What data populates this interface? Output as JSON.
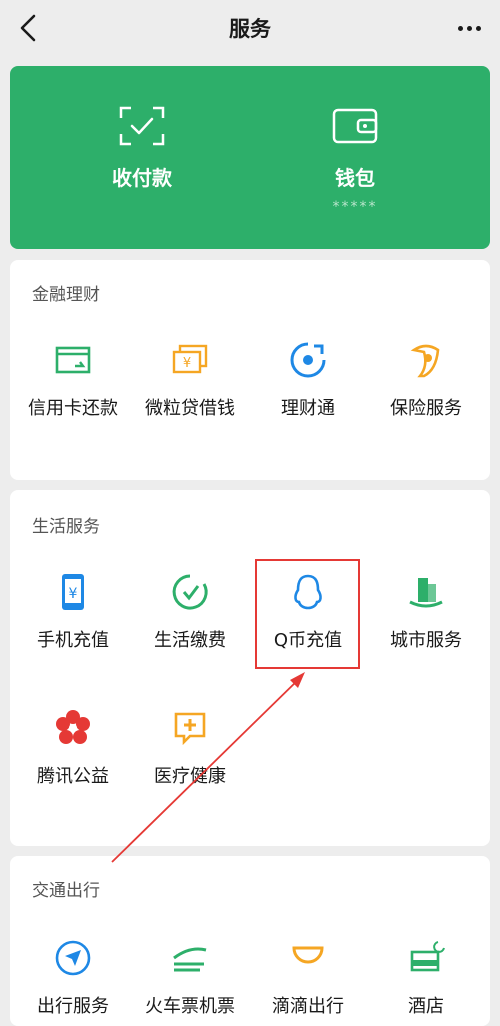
{
  "nav": {
    "title": "服务",
    "back_icon": "back-chevron-icon",
    "more_icon": "more-dots-icon"
  },
  "hero": {
    "background": "#2daf6a",
    "pay": {
      "label": "收付款",
      "icon": "scan-pay-icon"
    },
    "wallet": {
      "label": "钱包",
      "sub": "*****",
      "icon": "wallet-icon"
    }
  },
  "finance": {
    "title": "金融理财",
    "items": [
      {
        "label": "信用卡还款",
        "icon": "credit-card-icon",
        "color": "#2daf6a"
      },
      {
        "label": "微粒贷借钱",
        "icon": "cash-icon",
        "color": "#f5a623"
      },
      {
        "label": "理财通",
        "icon": "wealth-icon",
        "color": "#1e88e5"
      },
      {
        "label": "保险服务",
        "icon": "insurance-icon",
        "color": "#f5a623"
      }
    ]
  },
  "life": {
    "title": "生活服务",
    "items": [
      {
        "label": "手机充值",
        "icon": "mobile-topup-icon",
        "color": "#1e88e5"
      },
      {
        "label": "生活缴费",
        "icon": "utility-icon",
        "color": "#2daf6a"
      },
      {
        "label": "Q币充值",
        "icon": "qq-penguin-icon",
        "color": "#1e88e5"
      },
      {
        "label": "城市服务",
        "icon": "city-icon",
        "color": "#2daf6a"
      },
      {
        "label": "腾讯公益",
        "icon": "charity-flower-icon",
        "color": "#e53935"
      },
      {
        "label": "医疗健康",
        "icon": "medical-icon",
        "color": "#f5a623"
      }
    ]
  },
  "travel": {
    "title": "交通出行",
    "items": [
      {
        "label": "出行服务",
        "icon": "navigation-icon",
        "color": "#1e88e5"
      },
      {
        "label": "火车票机票",
        "icon": "train-icon",
        "color": "#2daf6a"
      },
      {
        "label": "滴滴出行",
        "icon": "didi-icon",
        "color": "#f5a623"
      },
      {
        "label": "酒店",
        "icon": "hotel-icon",
        "color": "#2daf6a"
      }
    ]
  },
  "annotation": {
    "color": "#e53935"
  }
}
